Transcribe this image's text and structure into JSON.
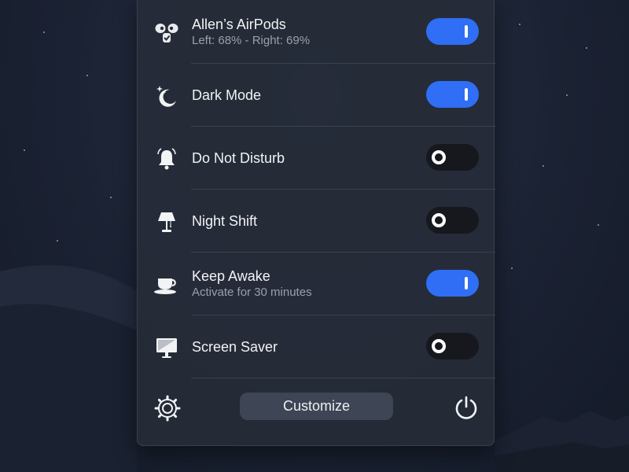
{
  "items": [
    {
      "id": "airpods",
      "title": "Allen’s AirPods",
      "subtitle": "Left: 68% - Right: 69%",
      "icon": "airpods-icon",
      "enabled": true
    },
    {
      "id": "dark-mode",
      "title": "Dark Mode",
      "subtitle": "",
      "icon": "moon-stars-icon",
      "enabled": true
    },
    {
      "id": "dnd",
      "title": "Do Not Disturb",
      "subtitle": "",
      "icon": "bell-icon",
      "enabled": false
    },
    {
      "id": "night-shift",
      "title": "Night Shift",
      "subtitle": "",
      "icon": "lamp-icon",
      "enabled": false
    },
    {
      "id": "keep-awake",
      "title": "Keep Awake",
      "subtitle": "Activate for 30 minutes",
      "icon": "coffee-cup-icon",
      "enabled": true
    },
    {
      "id": "screen-saver",
      "title": "Screen Saver",
      "subtitle": "",
      "icon": "monitor-icon",
      "enabled": false
    }
  ],
  "footer": {
    "customize_label": "Customize",
    "settings_icon": "gear-icon",
    "power_icon": "power-icon"
  },
  "colors": {
    "toggle_on": "#2f6ef5",
    "toggle_off": "#16181d",
    "panel": "#262c38",
    "button": "#3e4554"
  }
}
